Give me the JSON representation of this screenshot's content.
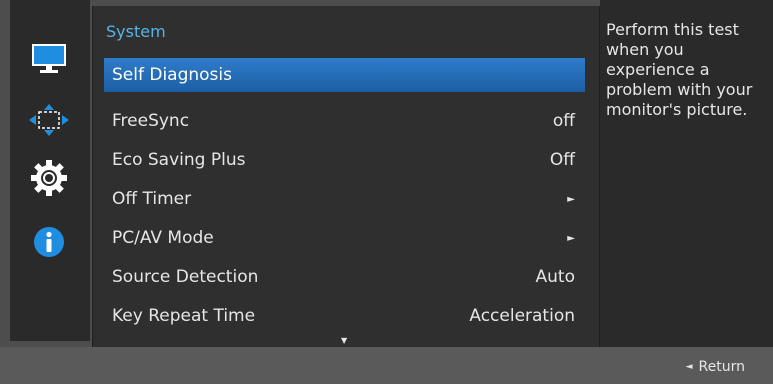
{
  "menu": {
    "title": "System",
    "items": [
      {
        "label": "Self Diagnosis",
        "value": ""
      },
      {
        "label": "FreeSync",
        "value": "off"
      },
      {
        "label": "Eco Saving Plus",
        "value": "Off"
      },
      {
        "label": "Off Timer",
        "value": "►"
      },
      {
        "label": "PC/AV Mode",
        "value": "►"
      },
      {
        "label": "Source Detection",
        "value": "Auto"
      },
      {
        "label": "Key Repeat Time",
        "value": "Acceleration"
      }
    ],
    "scroll_indicator": "▼"
  },
  "help": {
    "text": "Perform this test when you experience a problem with your monitor's picture."
  },
  "footer": {
    "return_arrow": "◄",
    "return_label": "Return"
  },
  "icons": {
    "picture": "monitor-icon",
    "position": "move-arrows-icon",
    "system": "gear-icon",
    "information": "info-icon"
  },
  "colors": {
    "accent": "#1c5ea4",
    "title": "#55b4e8"
  }
}
